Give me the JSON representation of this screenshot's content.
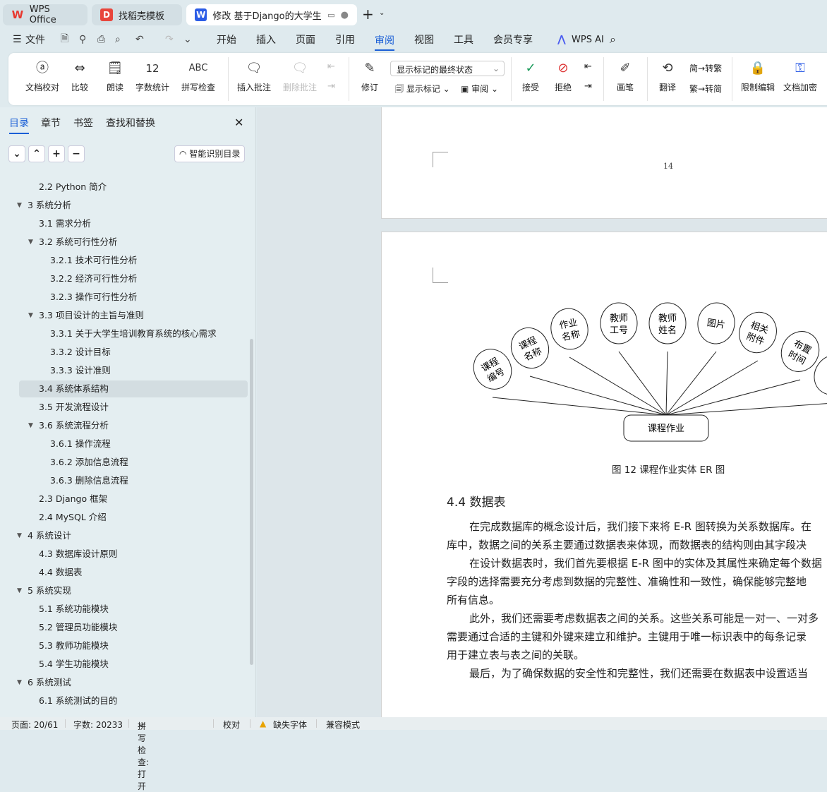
{
  "tabs": [
    {
      "label": "WPS Office",
      "icon": "wps-logo"
    },
    {
      "label": "找稻壳模板",
      "icon": "docer-logo"
    },
    {
      "label": "修改 基于Django的大学生培训",
      "icon": "writer-logo"
    }
  ],
  "menu": {
    "file": "文件",
    "items": [
      "开始",
      "插入",
      "页面",
      "引用",
      "审阅",
      "视图",
      "工具",
      "会员专享"
    ],
    "active": "审阅",
    "ai": "WPS AI"
  },
  "ribbon": {
    "proof": "文档校对",
    "compare": "比较",
    "read": "朗读",
    "count": "字数统计",
    "spell": "拼写检查",
    "insert_comment": "插入批注",
    "delete_comment": "删除批注",
    "revise": "修订",
    "markup_state": "显示标记的最终状态",
    "show_markup": "显示标记",
    "review": "审阅",
    "accept": "接受",
    "reject": "拒绝",
    "pen": "画笔",
    "translate": "翻译",
    "to_trad": "转繁",
    "to_simp": "转简",
    "restrict": "限制编辑",
    "encrypt": "文档加密"
  },
  "sidebar": {
    "tabs": [
      "目录",
      "章节",
      "书签",
      "查找和替换"
    ],
    "smart": "智能识别目录",
    "items": [
      {
        "label": "2.2 Python 简介",
        "level": 2,
        "arrow": false
      },
      {
        "label": "3  系统分析",
        "level": 1,
        "arrow": true
      },
      {
        "label": "3.1  需求分析",
        "level": 2,
        "arrow": false
      },
      {
        "label": "3.2  系统可行性分析",
        "level": 2,
        "arrow": true
      },
      {
        "label": "3.2.1  技术可行性分析",
        "level": 3,
        "arrow": false
      },
      {
        "label": "3.2.2  经济可行性分析",
        "level": 3,
        "arrow": false
      },
      {
        "label": "3.2.3  操作可行性分析",
        "level": 3,
        "arrow": false
      },
      {
        "label": "3.3  项目设计的主旨与准则",
        "level": 2,
        "arrow": true
      },
      {
        "label": "3.3.1 关于大学生培训教育系统的核心需求",
        "level": 3,
        "arrow": false
      },
      {
        "label": "3.3.2 设计目标",
        "level": 3,
        "arrow": false
      },
      {
        "label": "3.3.3 设计准则",
        "level": 3,
        "arrow": false
      },
      {
        "label": "3.4  系统体系结构",
        "level": 2,
        "arrow": false,
        "selected": true
      },
      {
        "label": "3.5  开发流程设计",
        "level": 2,
        "arrow": false
      },
      {
        "label": "3.6 系统流程分析",
        "level": 2,
        "arrow": true
      },
      {
        "label": "3.6.1 操作流程",
        "level": 3,
        "arrow": false
      },
      {
        "label": "3.6.2 添加信息流程",
        "level": 3,
        "arrow": false
      },
      {
        "label": "3.6.3 删除信息流程",
        "level": 3,
        "arrow": false
      },
      {
        "label": "2.3 Django 框架",
        "level": 2,
        "arrow": false
      },
      {
        "label": "2.4 MySQL 介绍",
        "level": 2,
        "arrow": false
      },
      {
        "label": "4  系统设计",
        "level": 1,
        "arrow": true
      },
      {
        "label": "4.3  数据库设计原则",
        "level": 2,
        "arrow": false
      },
      {
        "label": "4.4  数据表",
        "level": 2,
        "arrow": false
      },
      {
        "label": "5  系统实现",
        "level": 1,
        "arrow": true
      },
      {
        "label": "5.1 系统功能模块",
        "level": 2,
        "arrow": false
      },
      {
        "label": "5.2 管理员功能模块",
        "level": 2,
        "arrow": false
      },
      {
        "label": "5.3 教师功能模块",
        "level": 2,
        "arrow": false
      },
      {
        "label": "5.4 学生功能模块",
        "level": 2,
        "arrow": false
      },
      {
        "label": "6  系统测试",
        "level": 1,
        "arrow": true
      },
      {
        "label": "6.1 系统测试的目的",
        "level": 2,
        "arrow": false
      }
    ]
  },
  "document": {
    "page_number": "14",
    "er": {
      "entity": "课程作业",
      "attributes": [
        "课程\n编号",
        "课程\n名称",
        "作业\n名称",
        "教师\n工号",
        "教师\n姓名",
        "图片",
        "相关\n附件",
        "布置\n时间",
        ""
      ]
    },
    "caption": "图 12 课程作业实体 ER 图",
    "heading": "4.4  数据表",
    "lines": [
      {
        "text": "在完成数据库的概念设计后，我们接下来将 E-R 图转换为关系数据库。在",
        "indent": true
      },
      {
        "text": "库中，数据之间的关系主要通过数据表来体现，而数据表的结构则由其字段决",
        "indent": false
      },
      {
        "text": "在设计数据表时，我们首先要根据 E-R 图中的实体及其属性来确定每个数据",
        "indent": true
      },
      {
        "text": "字段的选择需要充分考虑到数据的完整性、准确性和一致性，确保能够完整地",
        "indent": false
      },
      {
        "text": "所有信息。",
        "indent": false
      },
      {
        "text": "此外，我们还需要考虑数据表之间的关系。这些关系可能是一对一、一对多",
        "indent": true
      },
      {
        "text": "需要通过合适的主键和外键来建立和维护。主键用于唯一标识表中的每条记录",
        "indent": false
      },
      {
        "text": "用于建立表与表之间的关联。",
        "indent": false
      },
      {
        "text": "最后，为了确保数据的安全性和完整性，我们还需要在数据表中设置适当",
        "indent": true
      }
    ]
  },
  "status": {
    "page": "页面: 20/61",
    "words": "字数: 20233",
    "spell": "拼写检查: 打开",
    "proof": "校对",
    "missing_font": "缺失字体",
    "compat": "兼容模式"
  },
  "colors": {
    "accent": "#1a5fd6",
    "wps_red": "#e8382f"
  }
}
